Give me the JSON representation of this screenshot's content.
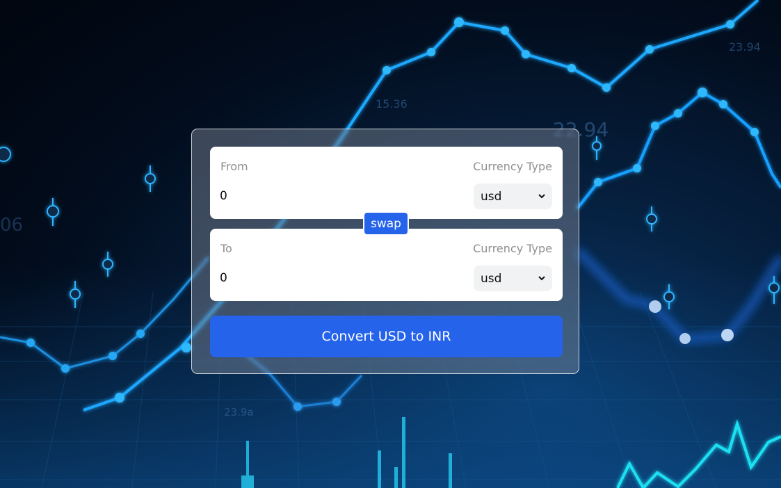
{
  "converter": {
    "from": {
      "label": "From",
      "currency_type_label": "Currency Type",
      "amount": "0",
      "currency": "usd"
    },
    "to": {
      "label": "To",
      "currency_type_label": "Currency Type",
      "amount": "0",
      "currency": "usd"
    },
    "swap_label": "swap",
    "convert_label": "Convert USD to INR"
  },
  "background": {
    "scene": "stock-chart-backdrop",
    "numbers": [
      "23.94",
      "15.36",
      "22.94",
      "23.9a",
      "06"
    ]
  },
  "colors": {
    "accent": "#2563eb",
    "panel": "#ffffff",
    "select_bg": "#f1f2f4",
    "label": "#8f8f8f"
  },
  "icons": {
    "select_arrow": "chevron-down-icon"
  }
}
